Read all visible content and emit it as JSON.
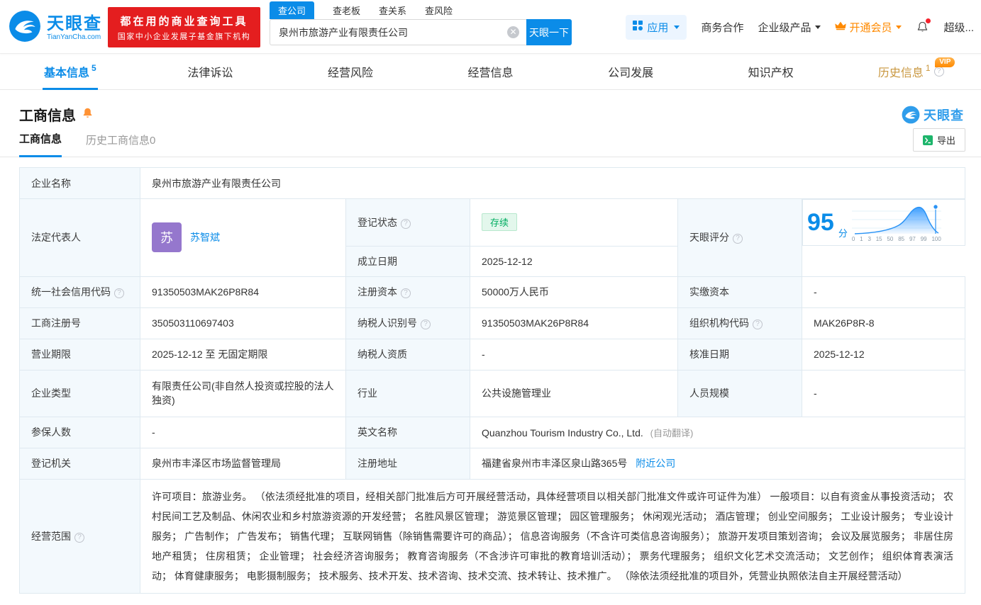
{
  "topbar": {
    "logo": {
      "brand": "天眼查",
      "domain": "TianYanCha.com"
    },
    "promo": {
      "line1": "都在用的商业查询工具",
      "line2": "国家中小企业发展子基金旗下机构"
    },
    "search": {
      "tabs": [
        {
          "label": "查公司"
        },
        {
          "label": "查老板"
        },
        {
          "label": "查关系"
        },
        {
          "label": "查风险"
        }
      ],
      "value": "泉州市旅游产业有限责任公司",
      "button": "天眼一下"
    },
    "nav": {
      "apps": "应用",
      "coop": "商务合作",
      "enterprise": "企业级产品",
      "vip": "开通会员",
      "super": "超级..."
    }
  },
  "tabbar": {
    "vip_badge": "VIP",
    "items": [
      {
        "label": "基本信息",
        "count": "5"
      },
      {
        "label": "法律诉讼",
        "count": ""
      },
      {
        "label": "经营风险",
        "count": ""
      },
      {
        "label": "经营信息",
        "count": ""
      },
      {
        "label": "公司发展",
        "count": ""
      },
      {
        "label": "知识产权",
        "count": ""
      },
      {
        "label": "历史信息",
        "count": "1"
      }
    ]
  },
  "section": {
    "title": "工商信息",
    "watermark": "天眼查",
    "subtab1": "工商信息",
    "subtab2": "历史工商信息0",
    "export": "导出"
  },
  "info": {
    "labels": {
      "company_name": "企业名称",
      "legal_rep": "法定代表人",
      "reg_status": "登记状态",
      "establish_date": "成立日期",
      "score": "天眼评分",
      "credit_code": "统一社会信用代码",
      "reg_capital": "注册资本",
      "paid_capital": "实缴资本",
      "reg_number": "工商注册号",
      "taxpayer_id": "纳税人识别号",
      "org_code": "组织机构代码",
      "business_term": "营业期限",
      "taxpayer_quality": "纳税人资质",
      "approve_date": "核准日期",
      "company_type": "企业类型",
      "industry": "行业",
      "staff_size": "人员规模",
      "insured_count": "参保人数",
      "english_name": "英文名称",
      "reg_authority": "登记机关",
      "reg_address": "注册地址",
      "business_scope": "经营范围"
    },
    "values": {
      "company_name": "泉州市旅游产业有限责任公司",
      "legal_rep_avatar": "苏",
      "legal_rep_name": "苏智斌",
      "reg_status": "存续",
      "establish_date": "2025-12-12",
      "credit_code": "91350503MAK26P8R84",
      "reg_capital": "50000万人民币",
      "paid_capital": "-",
      "reg_number": "350503110697403",
      "taxpayer_id": "91350503MAK26P8R84",
      "org_code": "MAK26P8R-8",
      "business_term": "2025-12-12 至 无固定期限",
      "taxpayer_quality": "-",
      "approve_date": "2025-12-12",
      "company_type": "有限责任公司(非自然人投资或控股的法人独资)",
      "industry": "公共设施管理业",
      "staff_size": "-",
      "insured_count": "-",
      "english_name": "Quanzhou Tourism Industry Co., Ltd.",
      "english_name_note": "(自动翻译)",
      "reg_authority": "泉州市丰泽区市场监督管理局",
      "reg_address": "福建省泉州市丰泽区泉山路365号",
      "nearby_link": "附近公司",
      "business_scope": "许可项目：旅游业务。 （依法须经批准的项目，经相关部门批准后方可开展经营活动，具体经营项目以相关部门批准文件或许可证件为准） 一般项目：以自有资金从事投资活动； 农村民间工艺及制品、休闲农业和乡村旅游资源的开发经营； 名胜风景区管理； 游览景区管理； 园区管理服务； 休闲观光活动； 酒店管理； 创业空间服务； 工业设计服务； 专业设计服务； 广告制作； 广告发布； 销售代理； 互联网销售（除销售需要许可的商品）； 信息咨询服务（不含许可类信息咨询服务）； 旅游开发项目策划咨询； 会议及展览服务； 非居住房地产租赁； 住房租赁； 企业管理； 社会经济咨询服务； 教育咨询服务（不含涉许可审批的教育培训活动）； 票务代理服务； 组织文化艺术交流活动； 文艺创作； 组织体育表演活动； 体育健康服务； 电影摄制服务； 技术服务、技术开发、技术咨询、技术交流、技术转让、技术推广。 （除依法须经批准的项目外，凭营业执照依法自主开展经营活动）"
    }
  },
  "score_chart": {
    "score": "95",
    "unit": "分",
    "ticks": [
      "0",
      "1",
      "3",
      "15",
      "50",
      "85",
      "97",
      "99",
      "100"
    ]
  }
}
